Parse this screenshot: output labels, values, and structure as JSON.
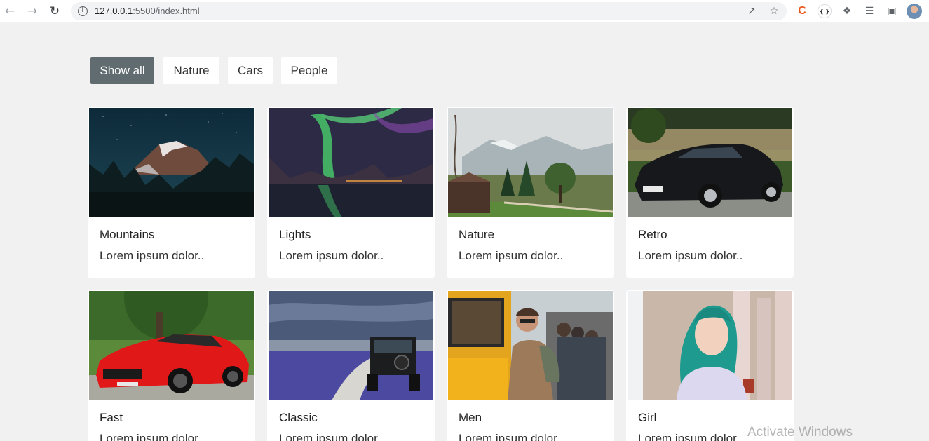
{
  "browser": {
    "back_icon": "arrow-left-icon",
    "forward_icon": "arrow-right-icon",
    "reload_icon": "reload-icon",
    "url_host": "127.0.0.1",
    "url_rest": ":5500/index.html"
  },
  "filters": [
    {
      "label": "Show all",
      "active": true
    },
    {
      "label": "Nature",
      "active": false
    },
    {
      "label": "Cars",
      "active": false
    },
    {
      "label": "People",
      "active": false
    }
  ],
  "cards": [
    {
      "title": "Mountains",
      "desc": "Lorem ipsum dolor..",
      "image": "mountain-night-photo"
    },
    {
      "title": "Lights",
      "desc": "Lorem ipsum dolor..",
      "image": "aurora-photo"
    },
    {
      "title": "Nature",
      "desc": "Lorem ipsum dolor..",
      "image": "valley-trees-photo"
    },
    {
      "title": "Retro",
      "desc": "Lorem ipsum dolor..",
      "image": "black-car-photo"
    },
    {
      "title": "Fast",
      "desc": "Lorem ipsum dolor..",
      "image": "red-sports-car-photo"
    },
    {
      "title": "Classic",
      "desc": "Lorem ipsum dolor..",
      "image": "offroad-jeep-photo"
    },
    {
      "title": "Men",
      "desc": "Lorem ipsum dolor..",
      "image": "man-train-photo"
    },
    {
      "title": "Girl",
      "desc": "Lorem ipsum dolor..",
      "image": "girl-portrait-photo"
    }
  ],
  "watermark": "Activate Windows"
}
